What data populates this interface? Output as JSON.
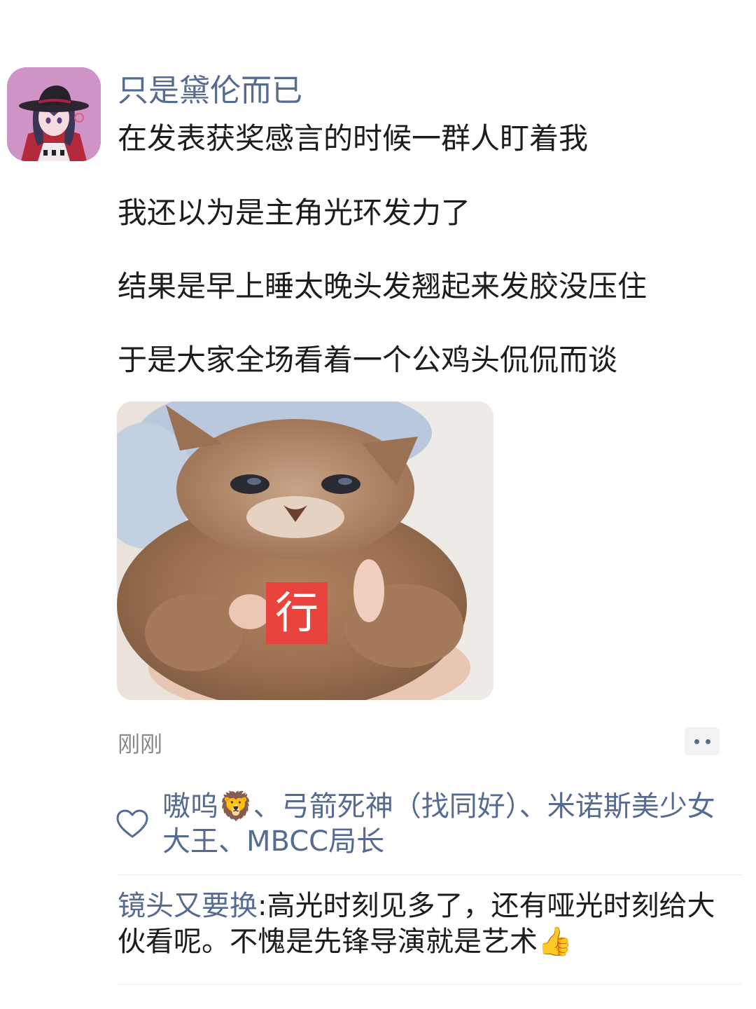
{
  "post": {
    "username": "只是黛伦而已",
    "lines": [
      "在发表获奖感言的时候一群人盯着我",
      "我还以为是主角光环发力了",
      "结果是早上睡太晚头发翘起来发胶没压住",
      "于是大家全场看着一个公鸡头侃侃而谈"
    ],
    "image_badge_text": "行",
    "timestamp": "刚刚"
  },
  "likes": {
    "text": "嗷呜🦁、弓箭死神（找同好）、米诺斯美少女大王、MBCC局长"
  },
  "comments": [
    {
      "author": "镜头又要换",
      "separator": ":",
      "text": "高光时刻见多了，还有哑光时刻给大伙看呢。不愧是先锋导演就是艺术👍"
    }
  ],
  "colors": {
    "name_blue": "#566b92",
    "badge_red": "#e8433d",
    "timestamp_gray": "#8a8a8a"
  },
  "icons": [
    "avatar",
    "heart-icon",
    "more-icon"
  ]
}
